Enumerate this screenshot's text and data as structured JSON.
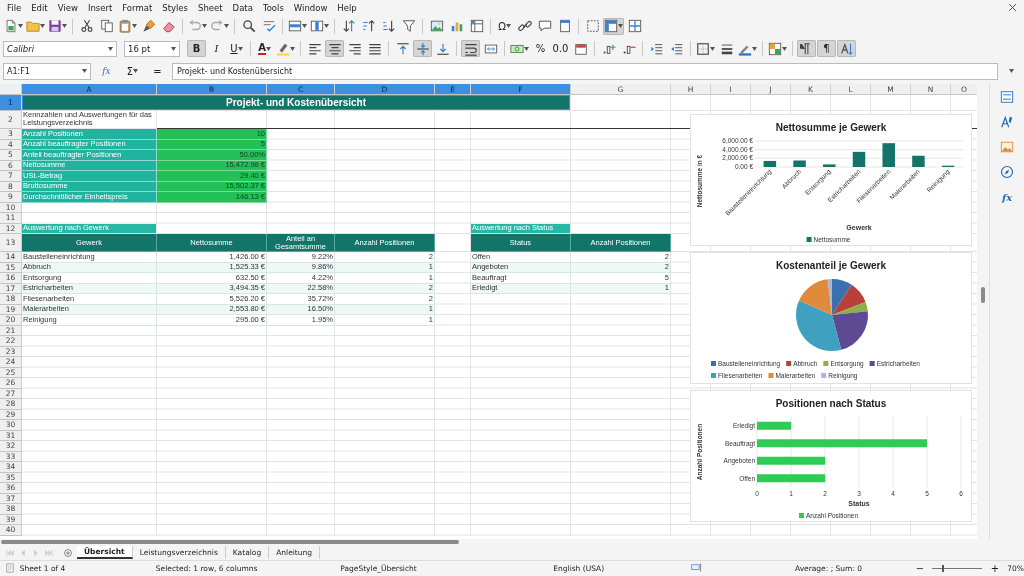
{
  "menu": [
    "File",
    "Edit",
    "View",
    "Insert",
    "Format",
    "Styles",
    "Sheet",
    "Data",
    "Tools",
    "Window",
    "Help"
  ],
  "toolbar": {
    "special_character": "Ω",
    "freeze": {
      "pressed": true
    }
  },
  "format_bar": {
    "font_name": "Calibri",
    "font_size": "16 pt",
    "buttons": [
      {
        "kind": "bold",
        "label": "B",
        "pressed": true
      },
      {
        "kind": "italic",
        "label": "I",
        "pressed": false
      },
      {
        "kind": "underline",
        "label": "U",
        "pressed": false,
        "dropdown": true
      },
      {
        "kind": "separator"
      },
      {
        "kind": "font-color",
        "label": "A",
        "color": "#c9211e",
        "dropdown": true
      },
      {
        "kind": "icon",
        "pressed": false,
        "dropdown": true
      },
      {
        "kind": "separator"
      },
      {
        "kind": "icon",
        "pressed": false
      },
      {
        "kind": "icon",
        "pressed": true
      },
      {
        "kind": "icon",
        "pressed": false
      },
      {
        "kind": "icon",
        "pressed": false
      },
      {
        "kind": "separator"
      },
      {
        "kind": "icon",
        "pressed": false
      },
      {
        "kind": "icon",
        "pressed": true
      },
      {
        "kind": "icon",
        "pressed": false
      },
      {
        "kind": "separator"
      },
      {
        "kind": "icon",
        "pressed": true
      },
      {
        "kind": "icon",
        "pressed": false
      },
      {
        "kind": "separator"
      },
      {
        "kind": "icon",
        "pressed": false,
        "dropdown": true
      },
      {
        "kind": "text",
        "label": "%",
        "pressed": false
      },
      {
        "kind": "text",
        "label": "0.0",
        "pressed": false
      },
      {
        "kind": "icon",
        "pressed": false
      },
      {
        "kind": "separator"
      },
      {
        "kind": "icon",
        "pressed": false
      },
      {
        "kind": "icon",
        "pressed": false
      },
      {
        "kind": "separator"
      },
      {
        "kind": "icon",
        "pressed": false
      },
      {
        "kind": "icon",
        "pressed": false
      },
      {
        "kind": "separator"
      },
      {
        "kind": "icon",
        "pressed": false,
        "dropdown": true
      },
      {
        "kind": "icon",
        "pressed": false
      },
      {
        "kind": "icon",
        "pressed": false,
        "dropdown": true
      },
      {
        "kind": "separator"
      },
      {
        "kind": "icon",
        "pressed": false,
        "dropdown": true
      },
      {
        "kind": "separator"
      },
      {
        "kind": "icon",
        "pressed": true
      },
      {
        "kind": "text",
        "label": "¶",
        "pressed": true
      },
      {
        "kind": "icon",
        "pressed": true
      }
    ]
  },
  "formula_bar": {
    "cell_reference": "A1:F1",
    "function_wizard": "fx",
    "sum": "Σ",
    "formula": "=",
    "content": "Projekt- und Kostenübersicht"
  },
  "columns": [
    {
      "label": "A",
      "selected": true
    },
    {
      "label": "B",
      "selected": true
    },
    {
      "label": "C",
      "selected": true
    },
    {
      "label": "D",
      "selected": true
    },
    {
      "label": "E",
      "selected": true
    },
    {
      "label": "F",
      "selected": true
    },
    {
      "label": "G",
      "selected": false
    },
    {
      "label": "H",
      "selected": false
    },
    {
      "label": "I",
      "selected": false
    },
    {
      "label": "J",
      "selected": false
    },
    {
      "label": "K",
      "selected": false
    },
    {
      "label": "L",
      "selected": false
    },
    {
      "label": "M",
      "selected": false
    },
    {
      "label": "N",
      "selected": false
    },
    {
      "label": "O",
      "selected": false
    }
  ],
  "row_headers": [
    {
      "label": "1",
      "selected": true
    },
    {
      "label": "2",
      "selected": false
    },
    {
      "label": "3",
      "selected": false
    },
    {
      "label": "4",
      "selected": false
    },
    {
      "label": "5",
      "selected": false
    },
    {
      "label": "6",
      "selected": false
    },
    {
      "label": "7",
      "selected": false
    },
    {
      "label": "8",
      "selected": false
    },
    {
      "label": "9",
      "selected": false
    },
    {
      "label": "10",
      "selected": false
    },
    {
      "label": "11",
      "selected": false
    },
    {
      "label": "12",
      "selected": false
    },
    {
      "label": "13",
      "selected": false
    },
    {
      "label": "14",
      "selected": false
    },
    {
      "label": "15",
      "selected": false
    },
    {
      "label": "16",
      "selected": false
    },
    {
      "label": "17",
      "selected": false
    },
    {
      "label": "18",
      "selected": false
    },
    {
      "label": "19",
      "selected": false
    },
    {
      "label": "20",
      "selected": false
    },
    {
      "label": "21",
      "selected": false
    },
    {
      "label": "22",
      "selected": false
    },
    {
      "label": "23",
      "selected": false
    },
    {
      "label": "24",
      "selected": false
    },
    {
      "label": "25",
      "selected": false
    },
    {
      "label": "26",
      "selected": false
    },
    {
      "label": "27",
      "selected": false
    },
    {
      "label": "28",
      "selected": false
    },
    {
      "label": "29",
      "selected": false
    },
    {
      "label": "30",
      "selected": false
    },
    {
      "label": "31",
      "selected": false
    },
    {
      "label": "32",
      "selected": false
    },
    {
      "label": "33",
      "selected": false
    },
    {
      "label": "34",
      "selected": false
    },
    {
      "label": "35",
      "selected": false
    },
    {
      "label": "36",
      "selected": false
    },
    {
      "label": "37",
      "selected": false
    },
    {
      "label": "38",
      "selected": false
    },
    {
      "label": "39",
      "selected": false
    },
    {
      "label": "40",
      "selected": false
    }
  ],
  "sheet": {
    "title": {
      "text": "Projekt- und Kostenübersicht",
      "selected": true
    },
    "subtitle": "Kennzahlen und Auswertungen für das Leistungsverzeichnis",
    "summary": [
      {
        "label": "Anzahl Positionen",
        "value": "10"
      },
      {
        "label": "Anzahl beauftragter Positionen",
        "value": "5"
      },
      {
        "label": "Anteil beauftragter Positionen",
        "value": "50.00%"
      },
      {
        "label": "Nettosumme",
        "value": "15,472.98 €"
      },
      {
        "label": "USt.-Betrag",
        "value": "29.40 €"
      },
      {
        "label": "Bruttosumme",
        "value": "15,502.37 €"
      },
      {
        "label": "Durchschnittlicher Einheitspreis",
        "value": "146.13 €"
      }
    ],
    "trade_table": {
      "caption": "Auswertung nach Gewerk",
      "columns": [
        "Gewerk",
        "Nettosumme",
        "Anteil an Gesamtsumme",
        "Anzahl Positionen"
      ],
      "rows": [
        [
          "Baustelleneinrichtung",
          "1,426.00 €",
          "9.22%",
          "2"
        ],
        [
          "Abbruch",
          "1,525.33 €",
          "9.86%",
          "1"
        ],
        [
          "Entsorgung",
          "632.50 €",
          "4.22%",
          "1"
        ],
        [
          "Estricharbeiten",
          "3,494.35 €",
          "22.58%",
          "2"
        ],
        [
          "Fliesenarbeiten",
          "5,526.20 €",
          "35.72%",
          "2"
        ],
        [
          "Malerarbeiten",
          "2,553.80 €",
          "16.50%",
          "1"
        ],
        [
          "Reinigung",
          "295.00 €",
          "1.95%",
          "1"
        ]
      ]
    },
    "status_table": {
      "caption": "Auswertung nach Status",
      "columns": [
        "Status",
        "Anzahl Positionen"
      ],
      "rows": [
        [
          "Offen",
          "2"
        ],
        [
          "Angeboten",
          "2"
        ],
        [
          "Beauftragt",
          "5"
        ],
        [
          "Erledigt",
          "1"
        ]
      ]
    }
  },
  "charts": [
    {
      "chart_data": {
        "type": "bar",
        "title": "Nettosumme je Gewerk",
        "xlabel": "Gewerk",
        "ylabel": "Nettosumme in €",
        "categories": [
          "Baustelleneinrichtung",
          "Abbruch",
          "Entsorgung",
          "Estricharbeiten",
          "Fliesenarbeiten",
          "Malerarbeiten",
          "Reinigung"
        ],
        "series": [
          {
            "name": "Nettosumme",
            "color": "#13756a",
            "values": [
              1400,
              1500,
              600,
              3500,
              5500,
              2600,
              300
            ]
          }
        ],
        "legend": "bottom",
        "grid": true,
        "ylim": [
          0,
          6000
        ],
        "yticks": [
          {
            "value": 0,
            "label": "0.00 €"
          },
          {
            "value": 2000,
            "label": "2,000.00 €"
          },
          {
            "value": 4000,
            "label": "4,000.00 €"
          },
          {
            "value": 6000,
            "label": "6,000.00 €"
          }
        ]
      }
    },
    {
      "chart_data": {
        "type": "pie",
        "title": "Kostenanteil je Gewerk",
        "categories": [
          "Baustelleneinrichtung",
          "Abbruch",
          "Entsorgung",
          "Estricharbeiten",
          "Fliesenarbeiten",
          "Malerarbeiten",
          "Reinigung"
        ],
        "colors": [
          "#3a6fb0",
          "#b8403a",
          "#8db04a",
          "#5d4a92",
          "#3fa0bf",
          "#e08a3c",
          "#a9b8d8"
        ],
        "legend": "bottom",
        "series": [
          {
            "values": [
              9.22,
              9.86,
              4.22,
              22.58,
              35.72,
              16.5,
              1.95
            ]
          }
        ]
      }
    },
    {
      "chart_data": {
        "type": "bar",
        "orientation": "horizontal",
        "title": "Positionen nach Status",
        "xlabel": "Status",
        "ylabel": "Anzahl Positionen",
        "categories": [
          "Erledigt",
          "Beauftragt",
          "Angeboten",
          "Offen"
        ],
        "series": [
          {
            "name": "Anzahl Positionen",
            "color": "#2ecc55",
            "values": [
              1,
              5,
              2,
              2
            ]
          }
        ],
        "legend": "bottom",
        "grid": true,
        "xlim": [
          0,
          6
        ],
        "xticks": [
          0,
          1,
          2,
          3,
          4,
          5,
          6
        ]
      }
    }
  ],
  "sidebar": {
    "functions": "fx"
  },
  "sheet_tabs": [
    {
      "label": "Übersicht",
      "selected": true
    },
    {
      "label": "Leistungsverzeichnis",
      "selected": false
    },
    {
      "label": "Katalog",
      "selected": false
    },
    {
      "label": "Anleitung",
      "selected": false
    }
  ],
  "status_bar": {
    "sheet": "Sheet 1 of 4",
    "selection": "Selected: 1 row, 6 columns",
    "page_style": "PageStyle_Übersicht",
    "language": "English (USA)",
    "sum": "Average: ; Sum: 0",
    "zoom_out": "−",
    "zoom_in": "+",
    "zoom": {
      "level": 0.2,
      "reading": "70%"
    }
  }
}
